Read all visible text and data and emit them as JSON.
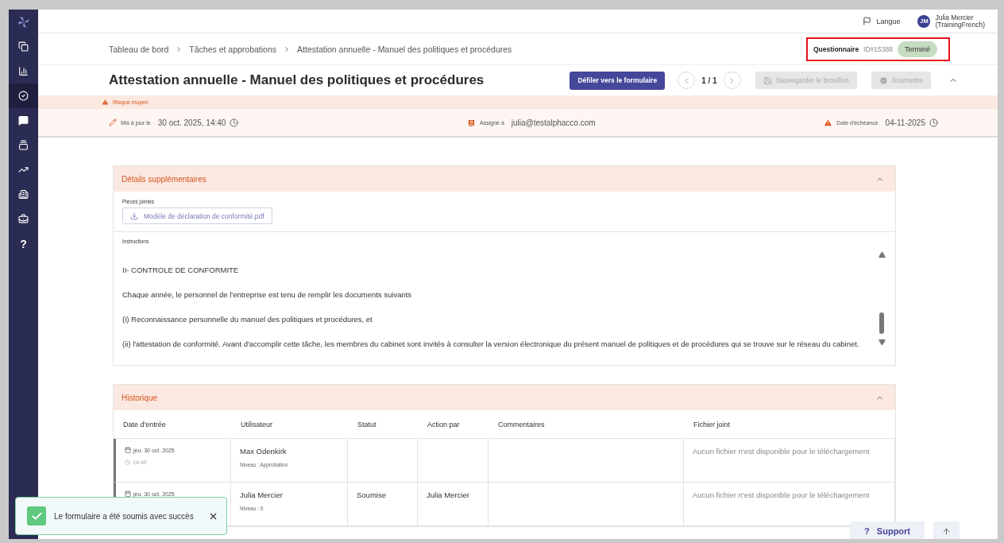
{
  "sidebar": {
    "items": [
      {
        "kind": "logo",
        "selected": false
      },
      {
        "kind": "copies",
        "selected": false
      },
      {
        "kind": "chart",
        "selected": false
      },
      {
        "kind": "check",
        "selected": true
      },
      {
        "kind": "chat",
        "selected": false
      },
      {
        "kind": "cards",
        "selected": false
      },
      {
        "kind": "trend",
        "selected": false
      },
      {
        "kind": "building",
        "selected": false
      },
      {
        "kind": "briefcase",
        "selected": false
      },
      {
        "kind": "help",
        "selected": false,
        "label": "?"
      }
    ]
  },
  "topbar": {
    "language": "Langue",
    "user_initials": "JM",
    "user_name": "Julia Mercier",
    "user_account": "(TrainingFrench)"
  },
  "breadcrumb": [
    "Tableau de bord",
    "Tâches et approbations",
    "Attestation annuelle - Manuel des politiques et procédures"
  ],
  "record": {
    "type": "Questionnaire",
    "id": "ID#15388",
    "status": "Terminé"
  },
  "title": "Attestation annuelle - Manuel des politiques et procédures",
  "actions": {
    "scroll_button": "Défiler vers le formulaire",
    "pager": "1 / 1",
    "save_draft": {
      "label": "Sauvegarder le brouillon",
      "disabled": true
    },
    "submit": {
      "label": "Soumettre",
      "disabled": true
    }
  },
  "risk": "Risque moyen",
  "meta": {
    "updated_label": "Mis à jour le",
    "updated_value": "30 oct. 2025, 14:40",
    "assigned_label": "Assigné à",
    "assigned_value": "julia@testalphacco.com",
    "due_label": "Date d'échéance",
    "due_value": "04-11-2025"
  },
  "details": {
    "title": "Détails supplémentaires",
    "expanded": true,
    "attachments_label": "Pièces jointes",
    "attachment": "Modèle de déclaration de conformité.pdf",
    "instructions_label": "Instructions",
    "paragraphs": [
      "II- CONTROLE DE CONFORMITE",
      "Chaque année, le personnel de l'entreprise est tenu de remplir les documents suivants",
      "(i) Reconnaissance personnelle du manuel des politiques et procédures, et",
      "(ii) l'attestation de conformité. Avant d'accomplir cette tâche, les membres du cabinet sont invités à consulter la version électronique du présent manuel de politiques et de procédures qui se trouve sur le réseau du cabinet."
    ]
  },
  "history": {
    "title": "Historique",
    "expanded": true,
    "columns": [
      "Date d'entrée",
      "Utilisateur",
      "Statut",
      "Action par",
      "Commentaires",
      "Fichier joint"
    ],
    "rows": [
      {
        "date": "jeu. 30 oct. 2025",
        "time": "14:40",
        "user": "Max Odenkirk",
        "level": "Niveau : Approbation",
        "file": "Aucun fichier n'est disponible pour le téléchargement"
      },
      {
        "date": "jeu. 30 oct. 2025",
        "user": "Julia Mercier",
        "level": "Niveau : 0",
        "status": "Soumise",
        "action_by": "Julia Mercier",
        "file": "Aucun fichier n'est disponible pour le téléchargement"
      }
    ]
  },
  "toast": {
    "message": "Le formulaire a été soumis avec succès"
  },
  "support": {
    "mark": "?",
    "label": "Support"
  }
}
